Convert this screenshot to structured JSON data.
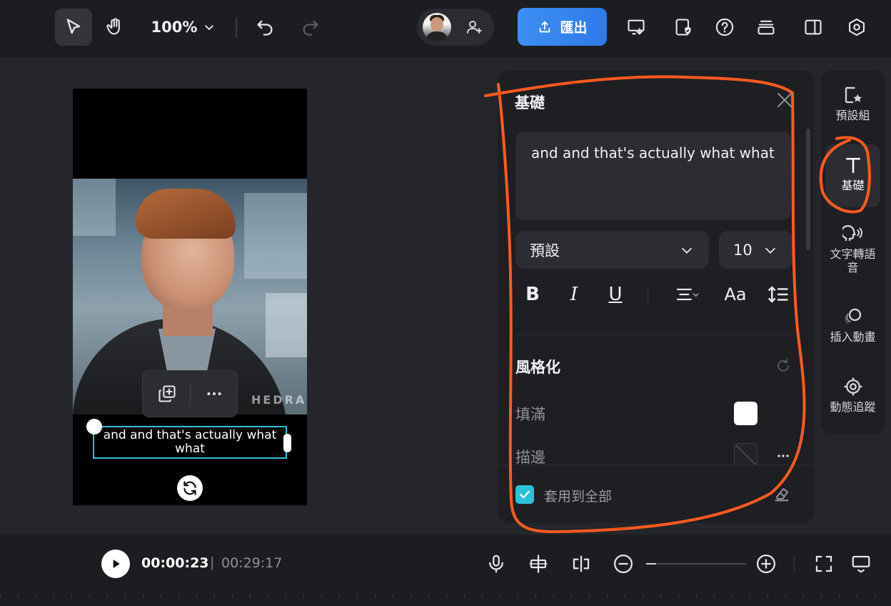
{
  "toolbar": {
    "zoom_value": "100%",
    "export_label": "匯出"
  },
  "canvas": {
    "caption": "and and that's actually what what",
    "watermark": "HEDRA"
  },
  "panel": {
    "title": "基礎",
    "text_content": "and and that's actually what what",
    "font_select": "預設",
    "font_size": "10",
    "format_buttons": [
      "B",
      "I",
      "U",
      "Aa"
    ],
    "section_title": "風格化",
    "fill_label": "填滿",
    "fill_color": "#ffffff",
    "stroke_label": "描邊",
    "apply_all_label": "套用到全部",
    "apply_all_checked": true
  },
  "rail": {
    "items": [
      {
        "label": "預設組",
        "icon": "preset-star-icon"
      },
      {
        "label": "基礎",
        "icon": "text-t-icon",
        "active": true
      },
      {
        "label": "文字轉語音",
        "icon": "text-to-speech-icon"
      },
      {
        "label": "插入動畫",
        "icon": "animation-icon"
      },
      {
        "label": "動態追蹤",
        "icon": "motion-tracking-icon"
      }
    ]
  },
  "playback": {
    "current_time": "00:00:23",
    "separator": "|",
    "total_time": "00:29:17",
    "zoom_level": 0.1
  },
  "colors": {
    "accent": "#2cc1d6",
    "export": "#3c8ff2",
    "annotation": "#ff5a1f"
  }
}
